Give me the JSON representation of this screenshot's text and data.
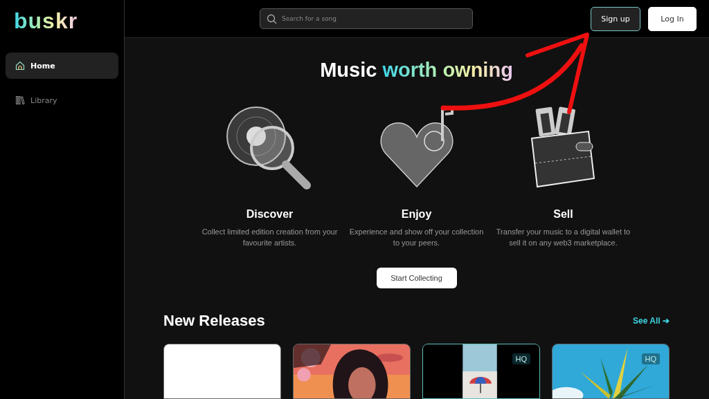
{
  "logo": "buskr",
  "sidebar": {
    "items": [
      {
        "label": "Home",
        "selected": true
      },
      {
        "label": "Library",
        "selected": false
      }
    ]
  },
  "search": {
    "placeholder": "Search for a song"
  },
  "auth_buttons": [
    {
      "label": "Sign up",
      "kind": "outline"
    },
    {
      "label": "Log In",
      "kind": "solid"
    }
  ],
  "hero": {
    "title": "Music",
    "highlight": "worth owning"
  },
  "features": [
    {
      "title": "Discover",
      "text": "Collect limited edition creation from your favourite artists."
    },
    {
      "title": "Enjoy",
      "text": "Experience and show off your collection to your peers."
    },
    {
      "title": "Sell",
      "text": "Transfer your music to a digital wallet to sell it on any web3 marketplace."
    }
  ],
  "cta": "Start Collecting",
  "new_releases": {
    "title": "New Releases",
    "see_all": "See All ➔",
    "cards": [
      {
        "kind": "blank",
        "highlighted": false
      },
      {
        "kind": "picture",
        "highlighted": false
      },
      {
        "kind": "picture",
        "badge": "HQ",
        "highlighted": true
      },
      {
        "kind": "picture",
        "badge": "HQ",
        "highlighted": false
      }
    ]
  }
}
